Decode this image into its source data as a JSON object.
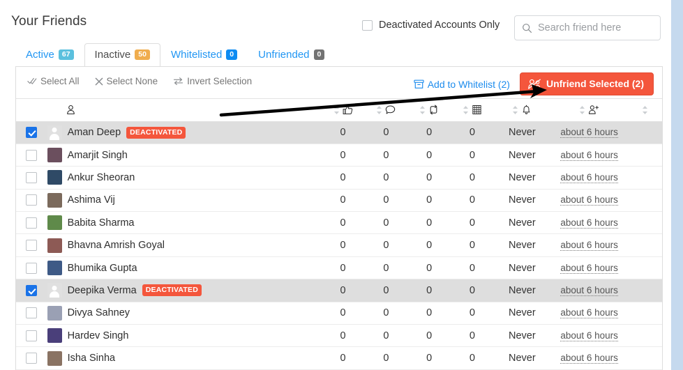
{
  "header": {
    "title": "Your Friends",
    "deactivated_only_label": "Deactivated Accounts Only",
    "deactivated_only_checked": false,
    "search_placeholder": "Search friend here",
    "search_value": ""
  },
  "tabs": [
    {
      "label": "Active",
      "count": "67",
      "active": false,
      "badge_color": "#5bc0de"
    },
    {
      "label": "Inactive",
      "count": "50",
      "active": true,
      "badge_color": "#f0ad4e"
    },
    {
      "label": "Whitelisted",
      "count": "0",
      "active": false,
      "badge_color": "#0d8bf2"
    },
    {
      "label": "Unfriended",
      "count": "0",
      "active": false,
      "badge_color": "#737373"
    }
  ],
  "toolbar": {
    "select_all": "Select All",
    "select_none": "Select None",
    "invert_selection": "Invert Selection",
    "add_to_whitelist": "Add to Whitelist (2)",
    "unfriend_selected": "Unfriend Selected (2)",
    "unfriend_color": "#f4563c",
    "link_color": "#1d8ced"
  },
  "table": {
    "columns": [
      {
        "key": "check",
        "icon": ""
      },
      {
        "key": "name",
        "icon": "person-icon"
      },
      {
        "key": "likes",
        "icon": "thumbs-up-icon"
      },
      {
        "key": "comments",
        "icon": "comment-icon"
      },
      {
        "key": "shares",
        "icon": "retweet-icon"
      },
      {
        "key": "posts",
        "icon": "grid-icon"
      },
      {
        "key": "notify",
        "icon": "bell-icon"
      },
      {
        "key": "friend",
        "icon": "user-plus-icon"
      },
      {
        "key": "tail",
        "icon": ""
      }
    ],
    "rows": [
      {
        "name": "Aman Deep",
        "deactivated": true,
        "selected": true,
        "likes": "0",
        "comments": "0",
        "shares": "0",
        "posts": "0",
        "notify": "Never",
        "last": "about 6 hours",
        "badge": "DEACTIVATED",
        "avatar": "#e0e0e0"
      },
      {
        "name": "Amarjit Singh",
        "deactivated": false,
        "selected": false,
        "likes": "0",
        "comments": "0",
        "shares": "0",
        "posts": "0",
        "notify": "Never",
        "last": "about 6 hours",
        "badge": "",
        "avatar": "#6b4f5e"
      },
      {
        "name": "Ankur Sheoran",
        "deactivated": false,
        "selected": false,
        "likes": "0",
        "comments": "0",
        "shares": "0",
        "posts": "0",
        "notify": "Never",
        "last": "about 6 hours",
        "badge": "",
        "avatar": "#2f4a66"
      },
      {
        "name": "Ashima Vij",
        "deactivated": false,
        "selected": false,
        "likes": "0",
        "comments": "0",
        "shares": "0",
        "posts": "0",
        "notify": "Never",
        "last": "about 6 hours",
        "badge": "",
        "avatar": "#7b6a5c"
      },
      {
        "name": "Babita Sharma",
        "deactivated": false,
        "selected": false,
        "likes": "0",
        "comments": "0",
        "shares": "0",
        "posts": "0",
        "notify": "Never",
        "last": "about 6 hours",
        "badge": "",
        "avatar": "#5f8a4a"
      },
      {
        "name": "Bhavna Amrish Goyal",
        "deactivated": false,
        "selected": false,
        "likes": "0",
        "comments": "0",
        "shares": "0",
        "posts": "0",
        "notify": "Never",
        "last": "about 6 hours",
        "badge": "",
        "avatar": "#8d5a55"
      },
      {
        "name": "Bhumika Gupta",
        "deactivated": false,
        "selected": false,
        "likes": "0",
        "comments": "0",
        "shares": "0",
        "posts": "0",
        "notify": "Never",
        "last": "about 6 hours",
        "badge": "",
        "avatar": "#3e5a86"
      },
      {
        "name": "Deepika Verma",
        "deactivated": true,
        "selected": true,
        "likes": "0",
        "comments": "0",
        "shares": "0",
        "posts": "0",
        "notify": "Never",
        "last": "about 6 hours",
        "badge": "DEACTIVATED",
        "avatar": "#e0e0e0"
      },
      {
        "name": "Divya Sahney",
        "deactivated": false,
        "selected": false,
        "likes": "0",
        "comments": "0",
        "shares": "0",
        "posts": "0",
        "notify": "Never",
        "last": "about 6 hours",
        "badge": "",
        "avatar": "#9aa0b4"
      },
      {
        "name": "Hardev Singh",
        "deactivated": false,
        "selected": false,
        "likes": "0",
        "comments": "0",
        "shares": "0",
        "posts": "0",
        "notify": "Never",
        "last": "about 6 hours",
        "badge": "",
        "avatar": "#4a3f7a"
      },
      {
        "name": "Isha Sinha",
        "deactivated": false,
        "selected": false,
        "likes": "0",
        "comments": "0",
        "shares": "0",
        "posts": "0",
        "notify": "Never",
        "last": "about 6 hours",
        "badge": "",
        "avatar": "#8a7363"
      }
    ]
  },
  "annotation": {
    "arrow": "black-arrow-pointing-to-unfriend-button"
  }
}
